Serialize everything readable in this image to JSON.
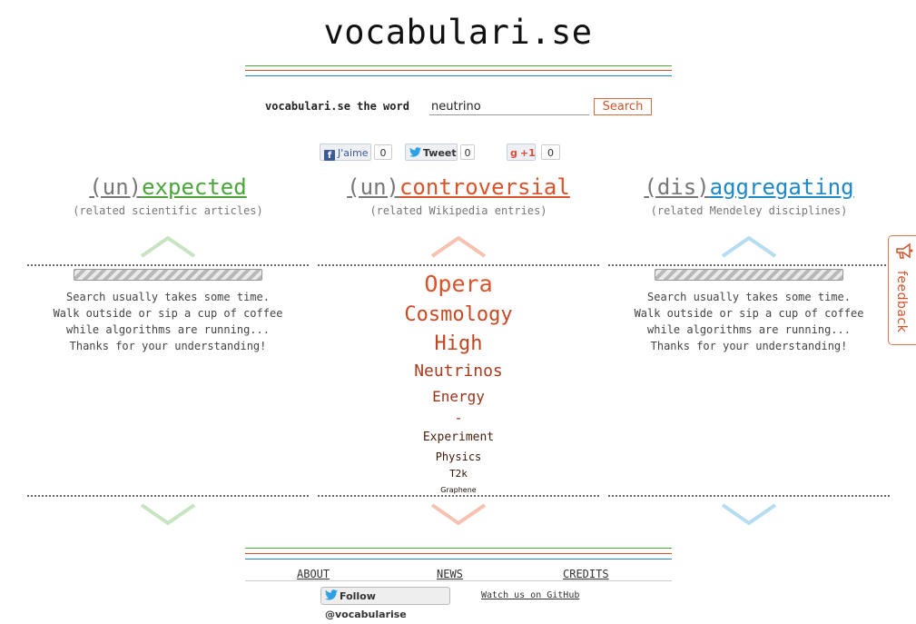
{
  "site": {
    "title": "vocabulari.se"
  },
  "colors": {
    "green": "#4aa63a",
    "orange": "#d9532b",
    "blue": "#1e88c8",
    "red_line": "#d9532b"
  },
  "search": {
    "label": "vocabulari.se the word",
    "value": "neutrino",
    "button": "Search"
  },
  "social": {
    "facebook": {
      "label": "J'aime",
      "count": "0",
      "icon": "facebook-icon"
    },
    "twitter": {
      "label": "Tweet",
      "count": "0",
      "icon": "twitter-bird-icon"
    },
    "gplus": {
      "label": "+1",
      "count": "0",
      "icon": "google-plus-icon"
    }
  },
  "columns": [
    {
      "prefix": "(un)",
      "word": "expected",
      "subtitle": "(related scientific articles)",
      "color": "#4aa63a"
    },
    {
      "prefix": "(un)",
      "word": "controversial",
      "subtitle": "(related Wikipedia entries)",
      "color": "#d9532b"
    },
    {
      "prefix": "(dis)",
      "word": "aggregating",
      "subtitle": "(related Mendeley disciplines)",
      "color": "#1e88c8"
    }
  ],
  "waiting": {
    "lines": [
      "Search usually takes some time.",
      "Walk outside or sip a cup of coffee",
      "while algorithms are running...",
      "Thanks for your understanding!"
    ]
  },
  "word_cloud": [
    "Opera",
    "Cosmology",
    "High",
    "Neutrinos",
    "Energy",
    "-",
    "Experiment",
    "Physics",
    "T2k",
    "Graphene"
  ],
  "footer": {
    "links": [
      "ABOUT",
      "NEWS",
      "CREDITS"
    ],
    "follow": "Follow @vocabularise",
    "github": "Watch us on GitHub"
  },
  "feedback": {
    "label": "feedback",
    "icon": "megaphone-icon"
  }
}
